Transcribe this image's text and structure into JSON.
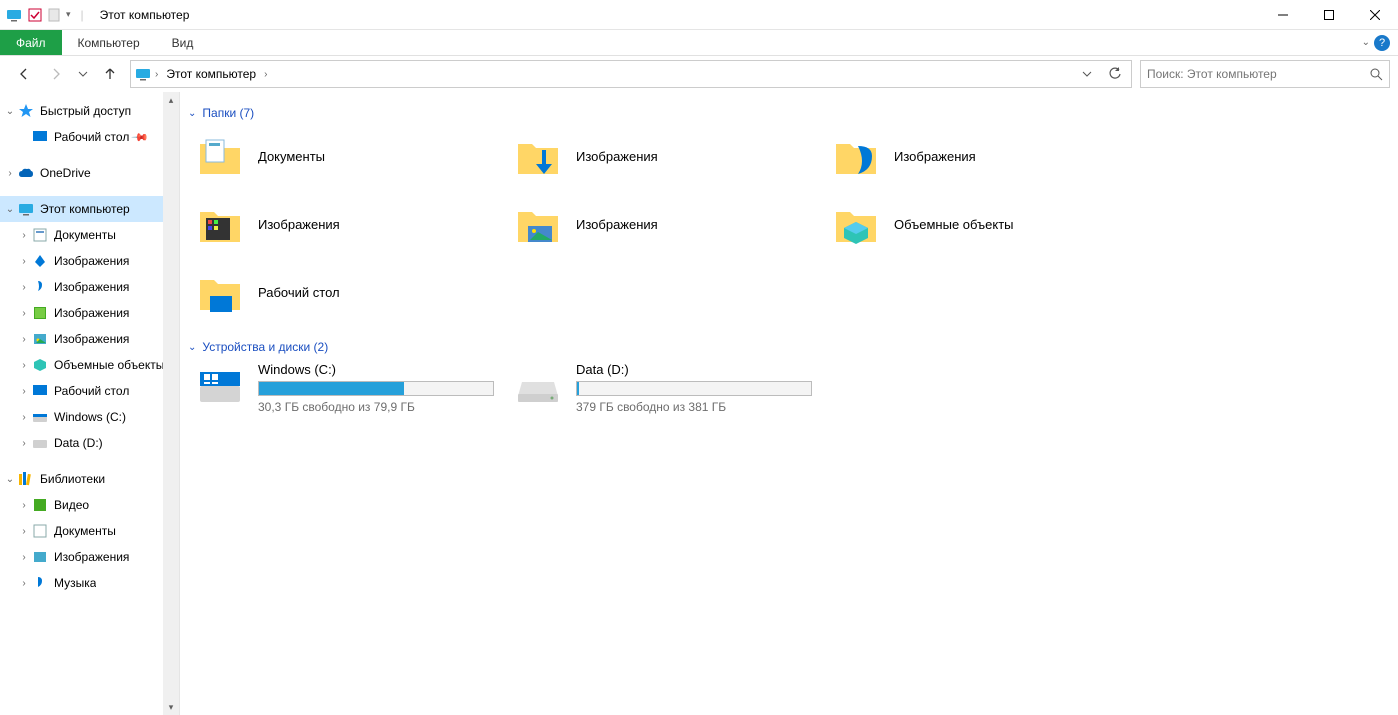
{
  "title": "Этот компьютер",
  "ribbon": {
    "file": "Файл",
    "computer": "Компьютер",
    "view": "Вид"
  },
  "breadcrumb": {
    "root": "Этот компьютер"
  },
  "search": {
    "placeholder": "Поиск: Этот компьютер"
  },
  "sidebar": {
    "quickaccess": {
      "label": "Быстрый доступ",
      "desktop": "Рабочий стол"
    },
    "onedrive": "OneDrive",
    "thispc": {
      "label": "Этот компьютер",
      "children": [
        "Документы",
        "Изображения",
        "Изображения",
        "Изображения",
        "Изображения",
        "Объемные объекты",
        "Рабочий стол",
        "Windows (C:)",
        "Data (D:)"
      ]
    },
    "libraries": {
      "label": "Библиотеки",
      "children": [
        "Видео",
        "Документы",
        "Изображения",
        "Музыка"
      ]
    }
  },
  "groups": {
    "folders": {
      "header": "Папки (7)"
    },
    "drives": {
      "header": "Устройства и диски (2)"
    }
  },
  "folders": [
    {
      "label": "Документы"
    },
    {
      "label": "Изображения"
    },
    {
      "label": "Изображения"
    },
    {
      "label": "Изображения"
    },
    {
      "label": "Изображения"
    },
    {
      "label": "Объемные объекты"
    },
    {
      "label": "Рабочий стол"
    }
  ],
  "drives": [
    {
      "name": "Windows (C:)",
      "status": "30,3 ГБ свободно из 79,9 ГБ",
      "fillPct": 62
    },
    {
      "name": "Data (D:)",
      "status": "379 ГБ свободно из 381 ГБ",
      "fillPct": 1
    }
  ]
}
